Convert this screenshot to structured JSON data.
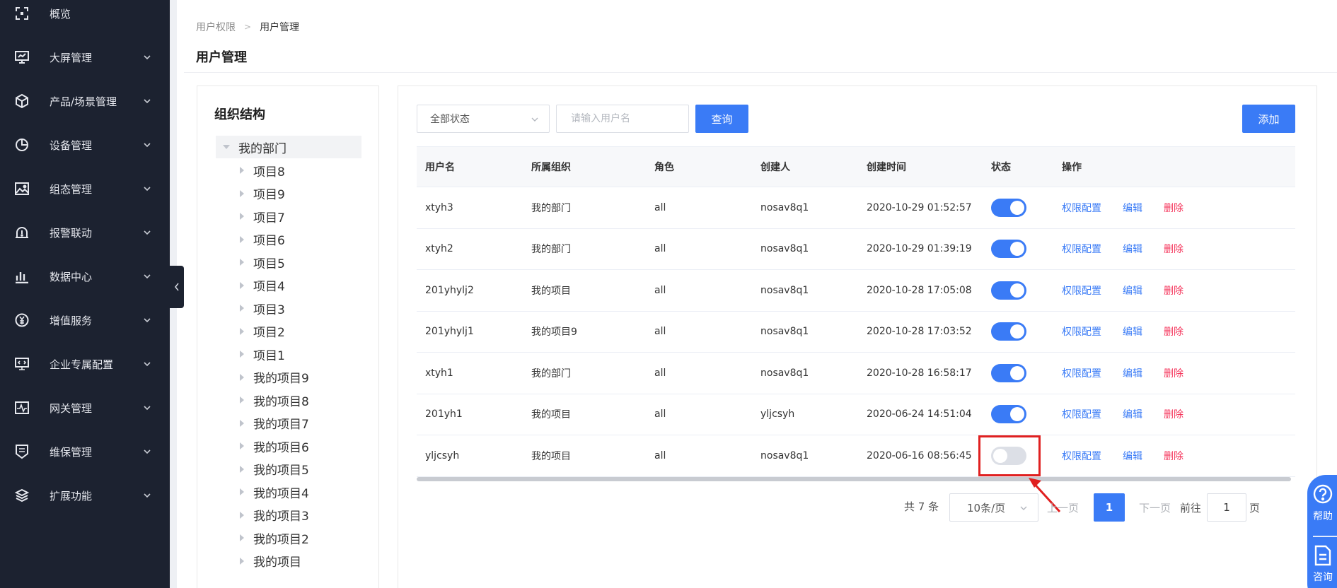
{
  "sidebar": {
    "items": [
      {
        "label": "概览",
        "icon": "overview-icon",
        "has_children": false
      },
      {
        "label": "大屏管理",
        "icon": "monitor-icon",
        "has_children": true
      },
      {
        "label": "产品/场景管理",
        "icon": "cube-icon",
        "has_children": true
      },
      {
        "label": "设备管理",
        "icon": "pie-chart-icon",
        "has_children": true
      },
      {
        "label": "组态管理",
        "icon": "image-icon",
        "has_children": true
      },
      {
        "label": "报警联动",
        "icon": "alarm-icon",
        "has_children": true
      },
      {
        "label": "数据中心",
        "icon": "bar-chart-icon",
        "has_children": true
      },
      {
        "label": "增值服务",
        "icon": "yen-icon",
        "has_children": true
      },
      {
        "label": "企业专属配置",
        "icon": "screen-config-icon",
        "has_children": true
      },
      {
        "label": "网关管理",
        "icon": "pulse-icon",
        "has_children": true
      },
      {
        "label": "维保管理",
        "icon": "shield-list-icon",
        "has_children": true
      },
      {
        "label": "扩展功能",
        "icon": "layers-icon",
        "has_children": true
      }
    ]
  },
  "breadcrumb": {
    "parent": "用户权限",
    "current": "用户管理"
  },
  "page_title": "用户管理",
  "org": {
    "title": "组织结构",
    "root": "我的部门",
    "nodes": [
      "项目8",
      "项目9",
      "项目7",
      "项目6",
      "项目5",
      "项目4",
      "项目3",
      "项目2",
      "项目1",
      "我的项目9",
      "我的项目8",
      "我的项目7",
      "我的项目6",
      "我的项目5",
      "我的项目4",
      "我的项目3",
      "我的项目2",
      "我的项目"
    ]
  },
  "toolbar": {
    "status_select": "全部状态",
    "search_placeholder": "请输入用户名",
    "query_label": "查询",
    "add_label": "添加"
  },
  "table": {
    "headers": {
      "user": "用户名",
      "org": "所属组织",
      "role": "角色",
      "creator": "创建人",
      "time": "创建时间",
      "status": "状态",
      "ops": "操作"
    },
    "rows": [
      {
        "user": "xtyh3",
        "org": "我的部门",
        "role": "all",
        "creator": "nosav8q1",
        "time": "2020-10-29 01:52:57",
        "enabled": true
      },
      {
        "user": "xtyh2",
        "org": "我的部门",
        "role": "all",
        "creator": "nosav8q1",
        "time": "2020-10-29 01:39:19",
        "enabled": true
      },
      {
        "user": "201yhylj2",
        "org": "我的项目",
        "role": "all",
        "creator": "nosav8q1",
        "time": "2020-10-28 17:05:08",
        "enabled": true
      },
      {
        "user": "201yhylj1",
        "org": "我的项目9",
        "role": "all",
        "creator": "nosav8q1",
        "time": "2020-10-28 17:03:52",
        "enabled": true
      },
      {
        "user": "xtyh1",
        "org": "我的部门",
        "role": "all",
        "creator": "nosav8q1",
        "time": "2020-10-28 16:58:17",
        "enabled": true
      },
      {
        "user": "201yh1",
        "org": "我的项目",
        "role": "all",
        "creator": "yljcsyh",
        "time": "2020-06-24 14:51:04",
        "enabled": true
      },
      {
        "user": "yljcsyh",
        "org": "我的项目",
        "role": "all",
        "creator": "nosav8q1",
        "time": "2020-06-16 08:56:45",
        "enabled": false
      }
    ],
    "ops": {
      "perm": "权限配置",
      "edit": "编辑",
      "del": "删除"
    }
  },
  "pagination": {
    "total": "共 7 条",
    "page_size": "10条/页",
    "prev": "上一页",
    "current": "1",
    "next": "下一页",
    "goto": "前往",
    "goto_value": "1",
    "unit": "页"
  },
  "help_widget": {
    "help": "帮助",
    "consult": "咨询"
  },
  "colors": {
    "sidebar_bg": "#1c2230",
    "primary": "#3a7bf6",
    "danger": "#f5365c",
    "highlight": "#e02020"
  }
}
